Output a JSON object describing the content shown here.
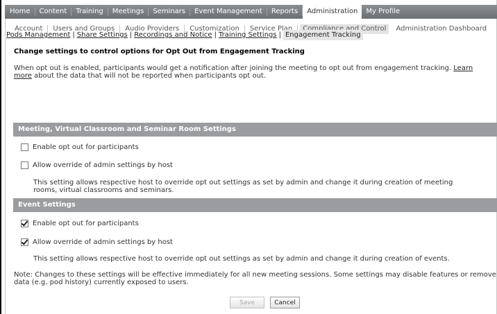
{
  "top_nav": {
    "tabs": [
      {
        "label": "Home"
      },
      {
        "label": "Content"
      },
      {
        "label": "Training"
      },
      {
        "label": "Meetings"
      },
      {
        "label": "Seminars"
      },
      {
        "label": "Event Management"
      },
      {
        "label": "Reports"
      },
      {
        "label": "Administration",
        "active": true
      },
      {
        "label": "My Profile"
      }
    ]
  },
  "sub_nav": {
    "items": [
      {
        "label": "Account"
      },
      {
        "label": "Users and Groups"
      },
      {
        "label": "Audio Providers"
      },
      {
        "label": "Customization"
      },
      {
        "label": "Service Plan"
      },
      {
        "label": "Compliance and Control",
        "active": true
      },
      {
        "label": "Administration Dashboard"
      }
    ]
  },
  "breadcrumbs": {
    "links": [
      "Pods Management",
      "Share Settings",
      "Recordings and Notice",
      "Training Settings"
    ],
    "separator": "|",
    "current": "Engagement Tracking"
  },
  "page": {
    "heading": "Change settings to control options for Opt Out from Engagement Tracking",
    "description_before": "When opt out is enabled, participants would get a notification after joining the meeting to opt out from engagement tracking. ",
    "description_link": "Learn more",
    "description_after": " about the data that will not be reported when participants opt out."
  },
  "sections": {
    "meeting": {
      "title": "Meeting, Virtual Classroom and Seminar Room Settings",
      "enable_label": "Enable opt out for participants",
      "enable_checked": false,
      "override_label": "Allow override of admin settings by host",
      "override_checked": false,
      "hint": "This setting allows respective host to override opt out settings as set by admin and change it during creation of meeting rooms, virtual classrooms and seminars."
    },
    "event": {
      "title": "Event Settings",
      "enable_label": "Enable opt out for participants",
      "enable_checked": true,
      "override_label": "Allow override of admin settings by host",
      "override_checked": true,
      "hint": "This setting allows respective host to override opt out settings as set by admin and change it during creation of events."
    }
  },
  "note": "Note: Changes to these settings will be effective immediately for all new meeting sessions. Some settings may disable features or remove data (e.g. pod history) currently exposed to users.",
  "buttons": {
    "save": "Save",
    "cancel": "Cancel"
  }
}
